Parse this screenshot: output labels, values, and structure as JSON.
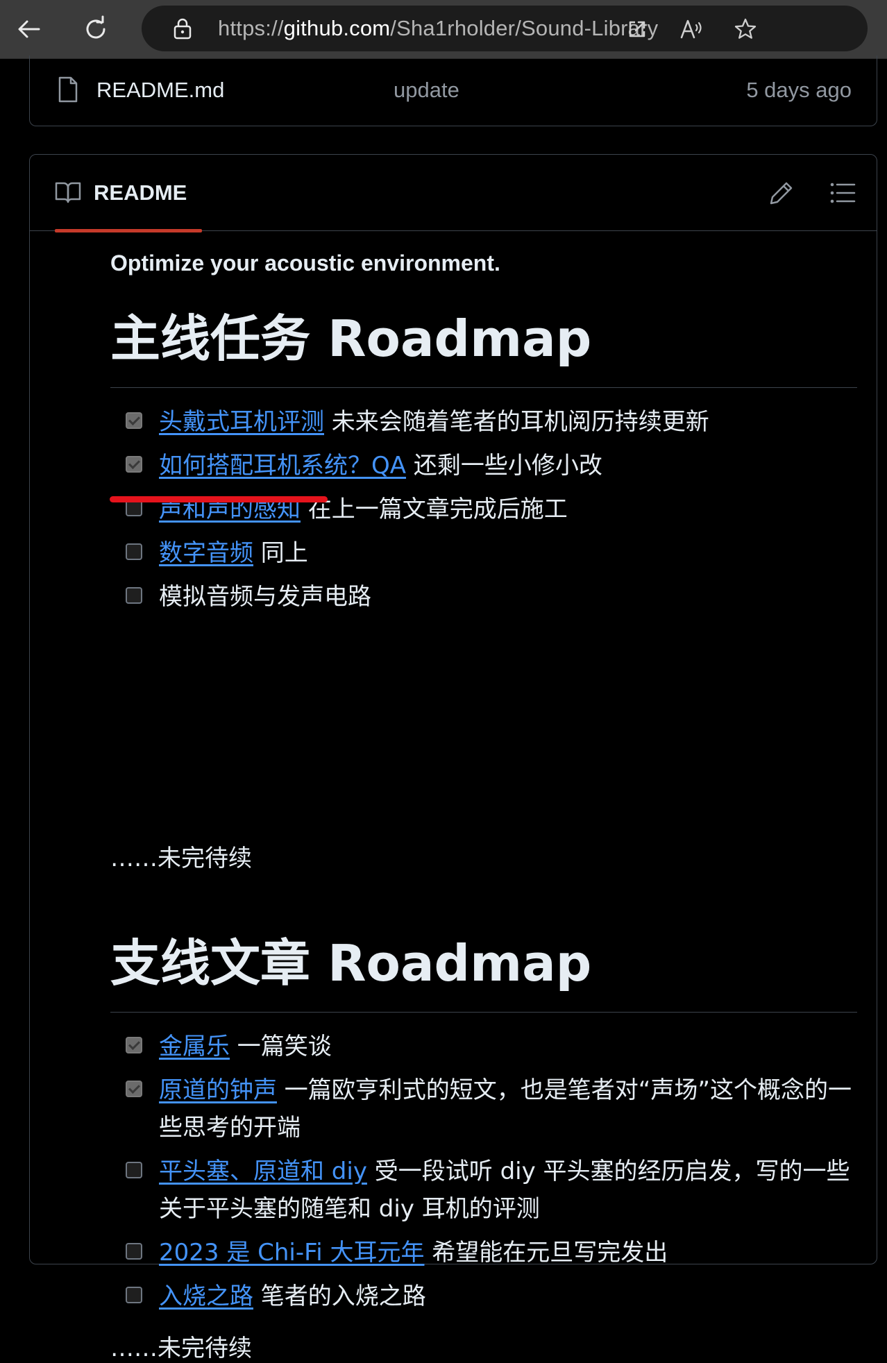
{
  "browser": {
    "url_prefix": "https://",
    "url_host": "github.com",
    "url_path": "/Sha1rholder/Sound-Library"
  },
  "file_row": {
    "name": "README.md",
    "commit_message": "update",
    "time": "5 days ago"
  },
  "readme": {
    "tab_label": "README",
    "tagline": "Optimize your acoustic environment.",
    "sections": [
      {
        "heading": "主线任务 Roadmap",
        "items": [
          {
            "checked": true,
            "link": "头戴式耳机评测",
            "text": " 未来会随着笔者的耳机阅历持续更新"
          },
          {
            "checked": true,
            "link": "如何搭配耳机系统？QA",
            "text": " 还剩一些小修小改"
          },
          {
            "checked": false,
            "link": "声和声的感知",
            "text": " 在上一篇文章完成后施工"
          },
          {
            "checked": false,
            "link": "数字音频",
            "text": " 同上"
          },
          {
            "checked": false,
            "link": "",
            "text": "模拟音频与发声电路"
          }
        ],
        "footer": "……未完待续"
      },
      {
        "heading": "支线文章 Roadmap",
        "items": [
          {
            "checked": true,
            "link": "金属乐",
            "text": " 一篇笑谈"
          },
          {
            "checked": true,
            "link": "原道的钟声",
            "text": " 一篇欧亨利式的短文，也是笔者对“声场”这个概念的一些思考的开端"
          },
          {
            "checked": false,
            "link": "平头塞、原道和 diy",
            "text": " 受一段试听 diy 平头塞的经历启发，写的一些关于平头塞的随笔和 diy 耳机的评测"
          },
          {
            "checked": false,
            "link": "2023 是 Chi-Fi 大耳元年",
            "text": " 希望能在元旦写完发出"
          },
          {
            "checked": false,
            "link": "入烧之路",
            "text": " 笔者的入烧之路"
          }
        ],
        "footer": "……未完待续"
      }
    ]
  },
  "colors": {
    "link": "#4493f8",
    "annotation": "#e5131c",
    "tab_underline": "#c53a2a"
  }
}
